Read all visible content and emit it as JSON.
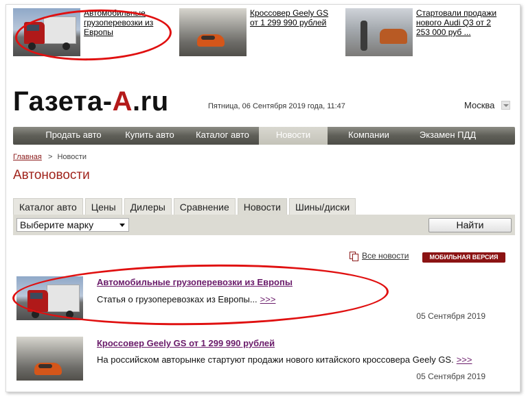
{
  "promo": [
    {
      "text": "Автомобильные грузоперевозки из Европы",
      "image": "truck-photo"
    },
    {
      "text": "Кроссовер Geely GS от 1 299 990 рублей",
      "image": "orange-crossover-photo"
    },
    {
      "text": "Стартовали продажи нового Audi Q3 от 2 253 000 руб ...",
      "image": "audi-q3-photo"
    }
  ],
  "header": {
    "logo_main": "Газета-",
    "logo_accent": "A",
    "logo_tail": ".ru",
    "dateline": "Пятница, 06 Сентября 2019 года, 11:47",
    "city": "Москва"
  },
  "nav": [
    "Продать авто",
    "Купить авто",
    "Каталог авто",
    "Новости",
    "Компании",
    "Экзамен ПДД"
  ],
  "nav_active": "Новости",
  "breadcrumb": {
    "home": "Главная",
    "sep": ">",
    "current": "Новости"
  },
  "page_title": "Автоновости",
  "tabs": [
    "Каталог авто",
    "Цены",
    "Дилеры",
    "Сравнение",
    "Новости",
    "Шины/диски"
  ],
  "tabs_active": "Новости",
  "filter": {
    "select_value": "Выберите марку",
    "find_label": "Найти"
  },
  "links": {
    "all_news": "Все новости",
    "mobile_version": "МОБИЛЬНАЯ ВЕРСИЯ"
  },
  "news": [
    {
      "title": "Автомобильные грузоперевозки из Европы",
      "desc": "Статья о грузоперевозках из Европы...",
      "more": ">>>",
      "date": "05 Сентября 2019"
    },
    {
      "title": "Кроссовер Geely GS от 1 299 990 рублей",
      "desc": "На российском авторынке стартуют продажи нового китайского кроссовера Geely GS.",
      "more": ">>>",
      "date": "05 Сентября 2019"
    }
  ],
  "colors": {
    "accent_red": "#a0231b",
    "link_purple": "#6a1b6a",
    "annotation_red": "#e01010"
  }
}
